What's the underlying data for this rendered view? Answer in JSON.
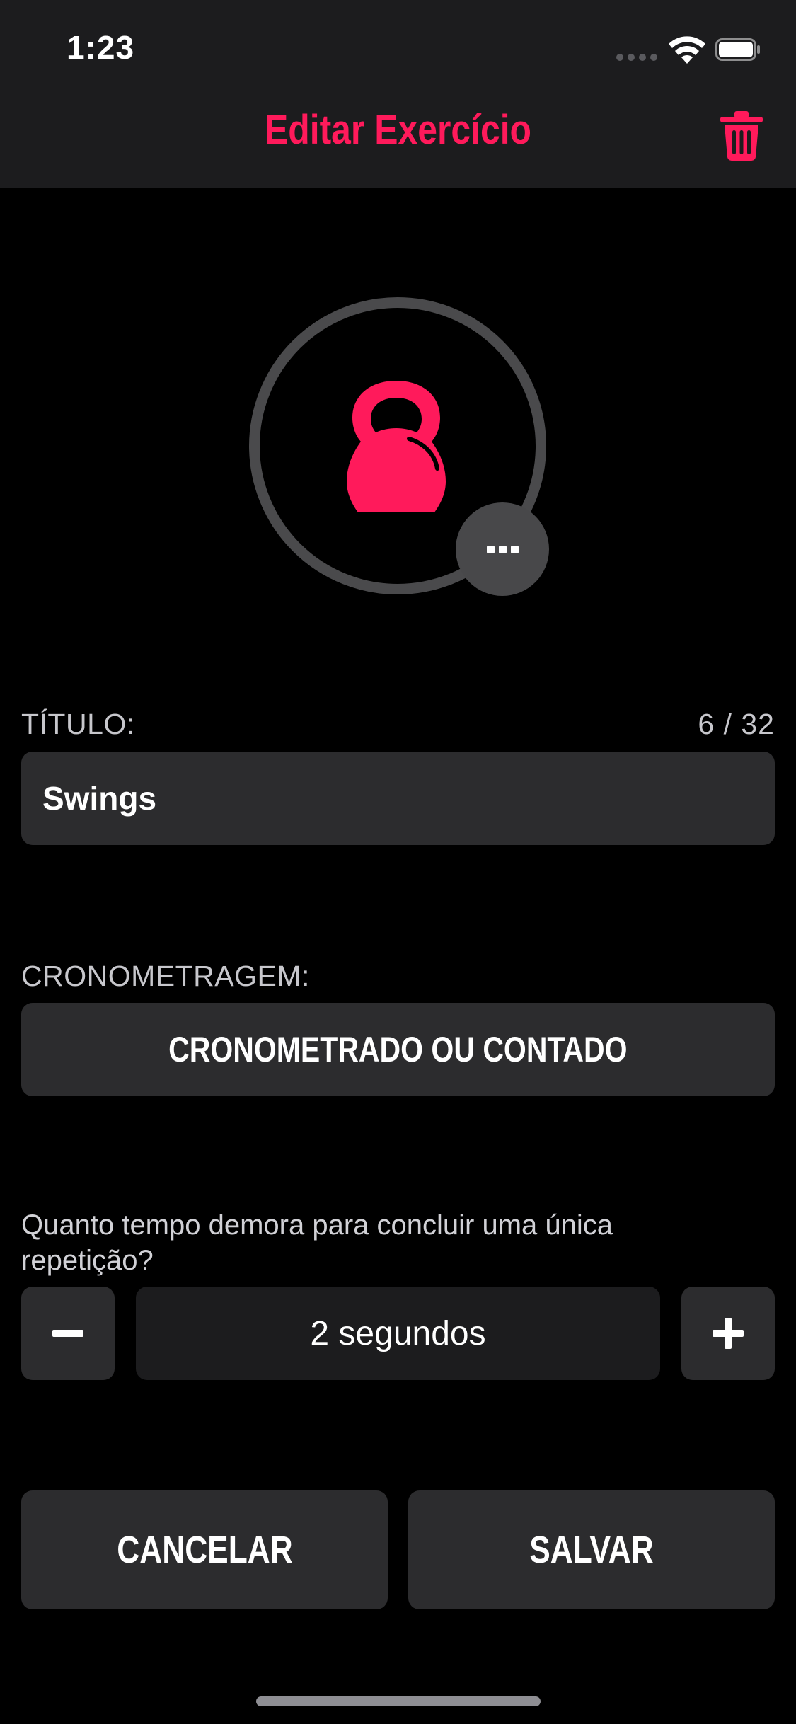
{
  "status_bar": {
    "time": "1:23"
  },
  "header": {
    "title": "Editar Exercício",
    "accent_color": "#ff1a5b",
    "trash_icon": "trash-icon"
  },
  "exercise_icon": {
    "icon": "kettlebell-icon",
    "more_icon": "ellipsis-icon"
  },
  "title_field": {
    "label": "TÍTULO:",
    "counter": "6 / 32",
    "value": "Swings"
  },
  "timing": {
    "label": "CRONOMETRAGEM:",
    "button_label": "CRONOMETRADO OU CONTADO"
  },
  "repetition": {
    "question": "Quanto tempo demora para concluir uma única repetição?",
    "value": "2 segundos",
    "minus_icon": "minus-icon",
    "plus_icon": "plus-icon"
  },
  "actions": {
    "cancel_label": "CANCELAR",
    "save_label": "SALVAR"
  }
}
